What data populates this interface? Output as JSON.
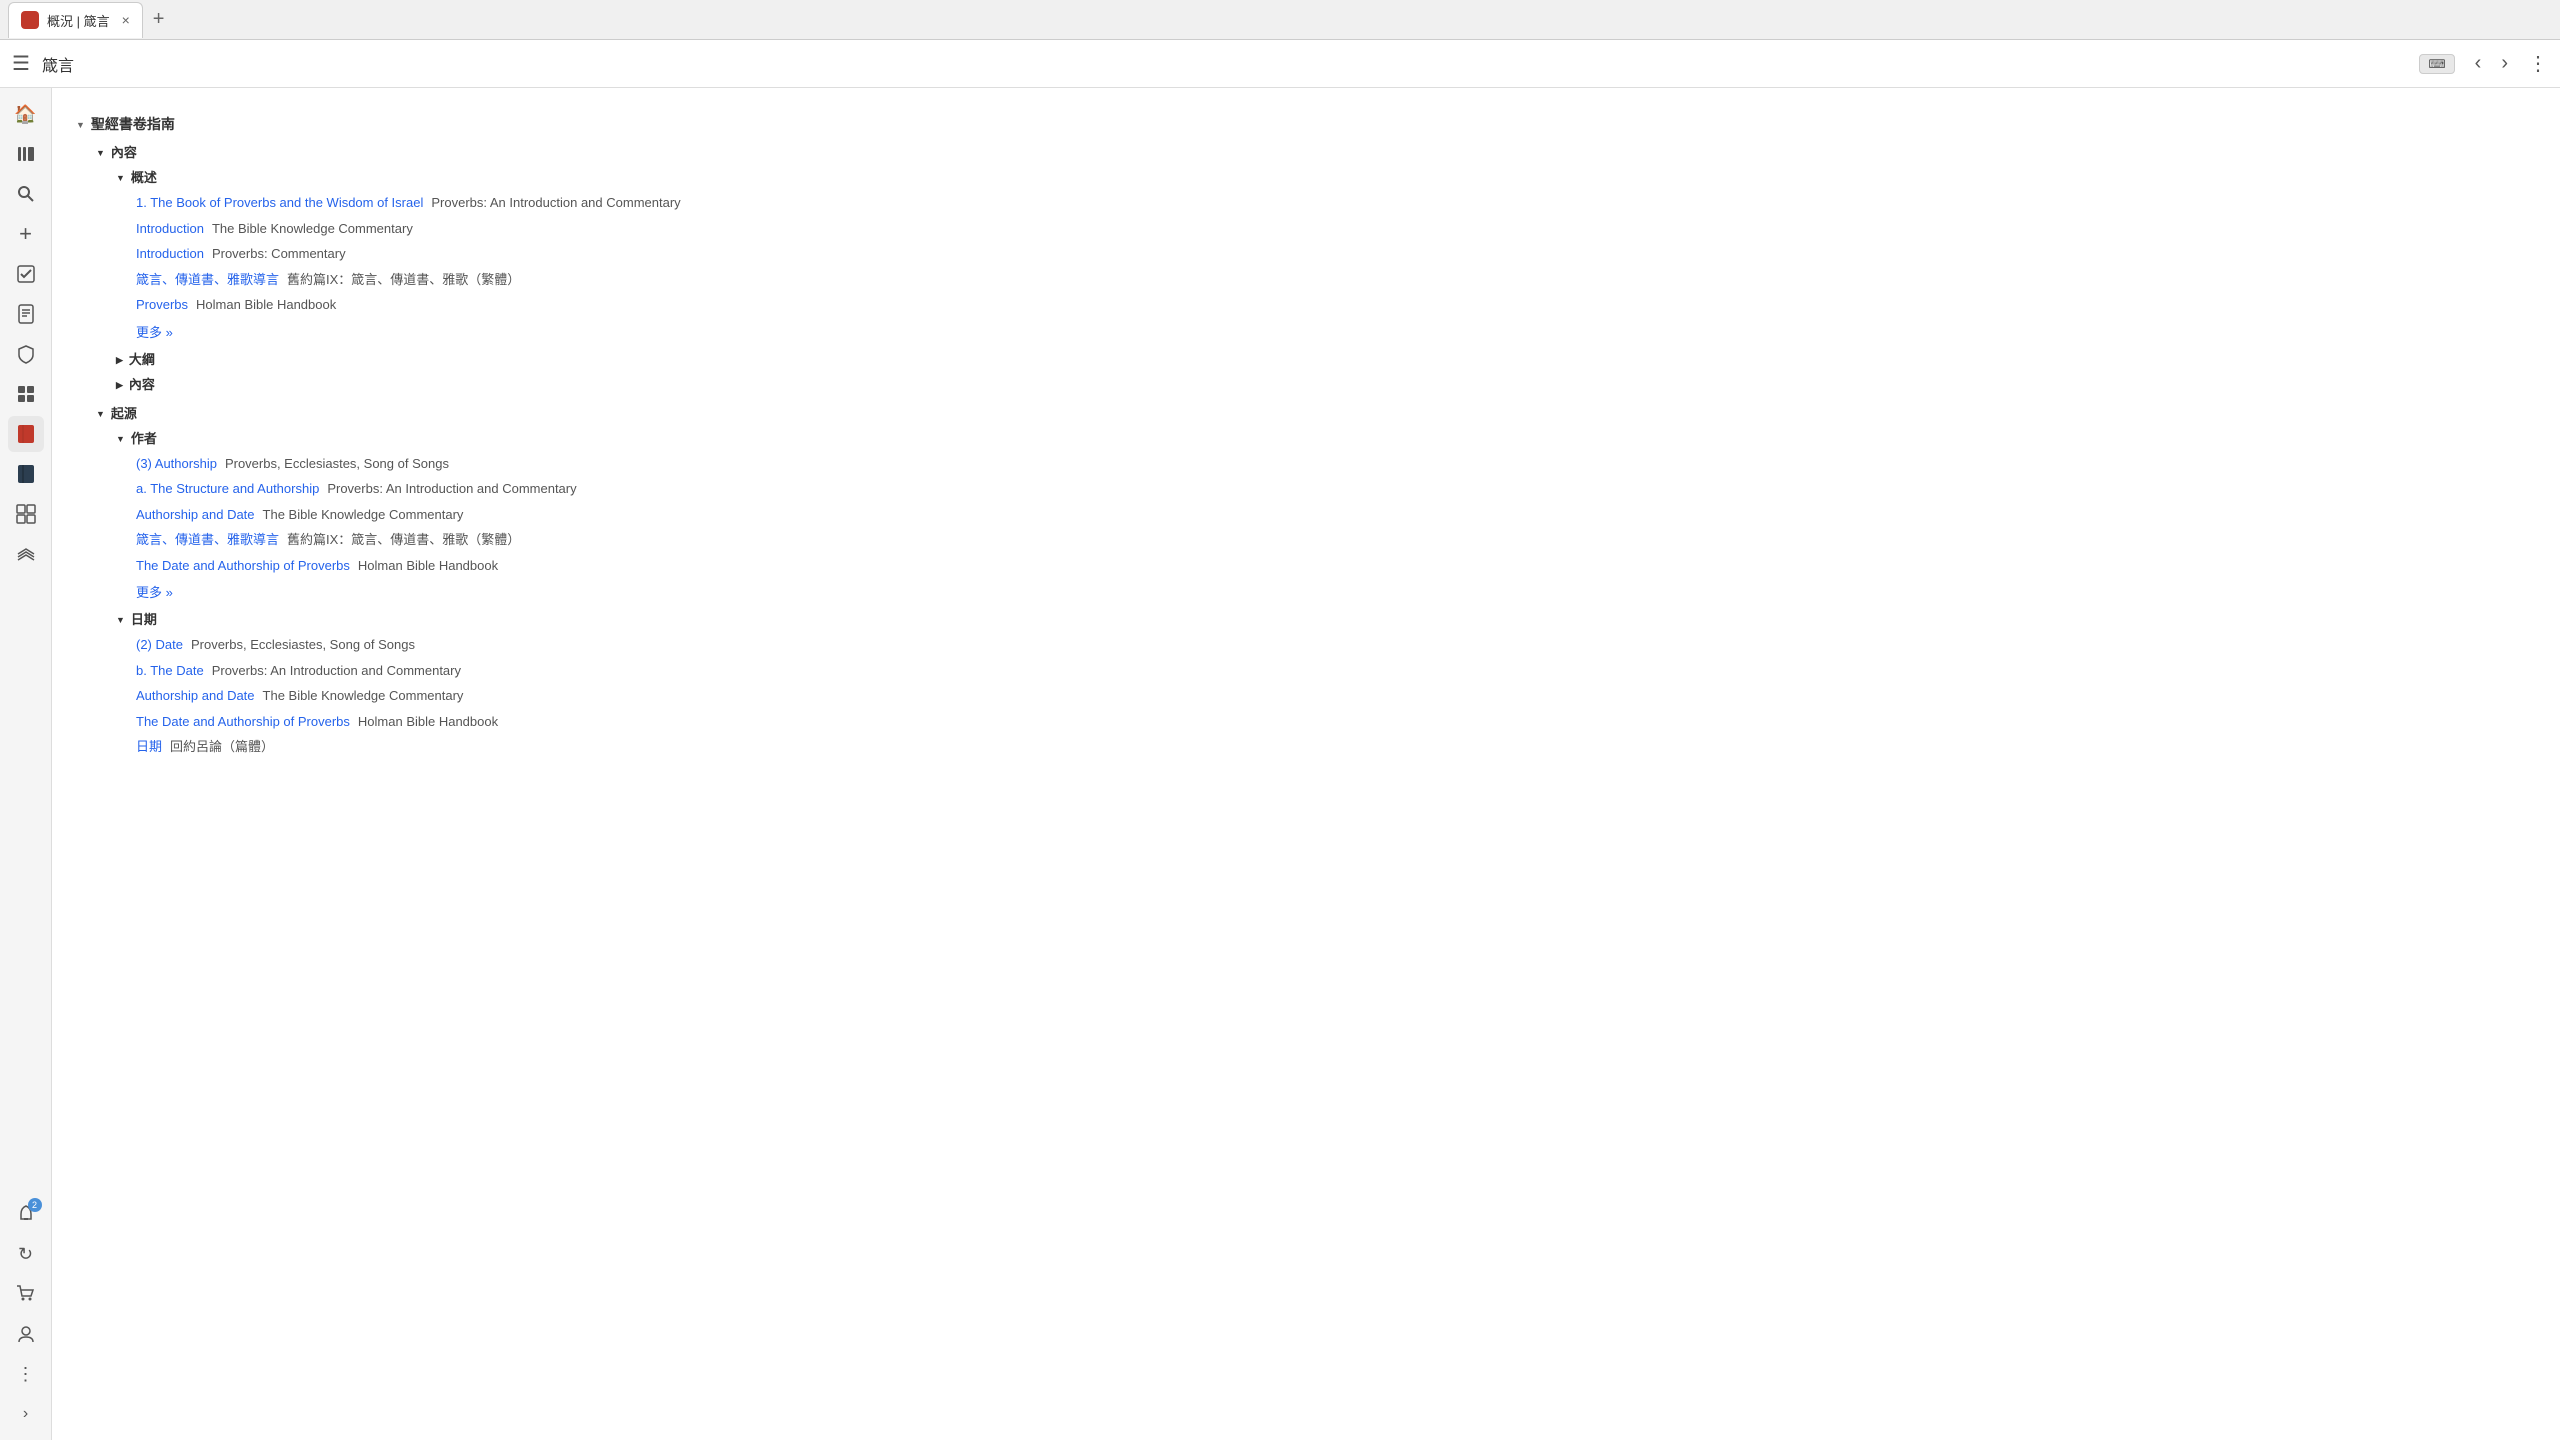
{
  "tab": {
    "icon_color": "#e05050",
    "label": "概況 | 箴言",
    "close_label": "×",
    "add_label": "+"
  },
  "toolbar": {
    "menu_icon": "☰",
    "title": "箴言",
    "kbd_label": "⌨",
    "nav_back": "‹",
    "nav_forward": "›",
    "more": "⋮"
  },
  "sidebar": {
    "icons": [
      {
        "name": "home",
        "glyph": "🏠",
        "active": false
      },
      {
        "name": "library",
        "glyph": "📚",
        "active": false
      },
      {
        "name": "search",
        "glyph": "🔍",
        "active": false
      },
      {
        "name": "add",
        "glyph": "+",
        "active": false
      },
      {
        "name": "check",
        "glyph": "✓",
        "active": false
      },
      {
        "name": "document",
        "glyph": "📄",
        "active": false
      },
      {
        "name": "shield",
        "glyph": "🛡",
        "active": false
      },
      {
        "name": "grid",
        "glyph": "⋮⋮",
        "active": false
      },
      {
        "name": "book-red",
        "glyph": "📕",
        "active": true
      },
      {
        "name": "book-dark",
        "glyph": "📗",
        "active": false
      },
      {
        "name": "modules",
        "glyph": "⊞",
        "active": false
      },
      {
        "name": "layers",
        "glyph": "⧉",
        "active": false
      },
      {
        "name": "notification",
        "glyph": "🔔",
        "badge": "2"
      },
      {
        "name": "refresh",
        "glyph": "↻",
        "active": false
      },
      {
        "name": "cart",
        "glyph": "🛒",
        "active": false
      },
      {
        "name": "user",
        "glyph": "👤",
        "active": false
      },
      {
        "name": "more-vert",
        "glyph": "⋮",
        "active": false
      },
      {
        "name": "expand",
        "glyph": "›",
        "active": false
      }
    ]
  },
  "page": {
    "top_section": "聖經書卷指南",
    "sections": [
      {
        "name": "內容",
        "collapsed": false,
        "subsections": [
          {
            "name": "概述",
            "collapsed": false,
            "items": [
              {
                "link": "1. The Book of Proverbs and the Wisdom of Israel",
                "source": "Proverbs: An Introduction and Commentary"
              },
              {
                "link": "Introduction",
                "source": "The Bible Knowledge Commentary"
              },
              {
                "link": "Introduction",
                "source": "Proverbs: Commentary"
              },
              {
                "link": "箴言、傳道書、雅歌導言",
                "source": "舊約篇IX：箴言、傳道書、雅歌（繁體）"
              },
              {
                "link": "Proverbs",
                "source": "Holman Bible Handbook"
              }
            ],
            "more": "更多 »"
          },
          {
            "name": "大綱",
            "collapsed": true,
            "items": []
          },
          {
            "name": "內容",
            "collapsed": true,
            "items": []
          }
        ]
      },
      {
        "name": "起源",
        "collapsed": false,
        "subsections": [
          {
            "name": "作者",
            "collapsed": false,
            "items": [
              {
                "link": "(3) Authorship",
                "source": "Proverbs, Ecclesiastes, Song of Songs"
              },
              {
                "link": "a. The Structure and Authorship",
                "source": "Proverbs: An Introduction and Commentary"
              },
              {
                "link": "Authorship and Date",
                "source": "The Bible Knowledge Commentary"
              },
              {
                "link": "箴言、傳道書、雅歌導言",
                "source": "舊約篇IX：箴言、傳道書、雅歌（繁體）"
              },
              {
                "link": "The Date and Authorship of Proverbs",
                "source": "Holman Bible Handbook"
              }
            ],
            "more": "更多 »"
          },
          {
            "name": "日期",
            "collapsed": false,
            "items": [
              {
                "link": "(2) Date",
                "source": "Proverbs, Ecclesiastes, Song of Songs"
              },
              {
                "link": "b. The Date",
                "source": "Proverbs: An Introduction and Commentary"
              },
              {
                "link": "Authorship and Date",
                "source": "The Bible Knowledge Commentary"
              },
              {
                "link": "The Date and Authorship of Proverbs",
                "source": "Holman Bible Handbook"
              },
              {
                "link": "日期",
                "source": "回約呂論（篇體）"
              }
            ]
          }
        ]
      }
    ]
  }
}
